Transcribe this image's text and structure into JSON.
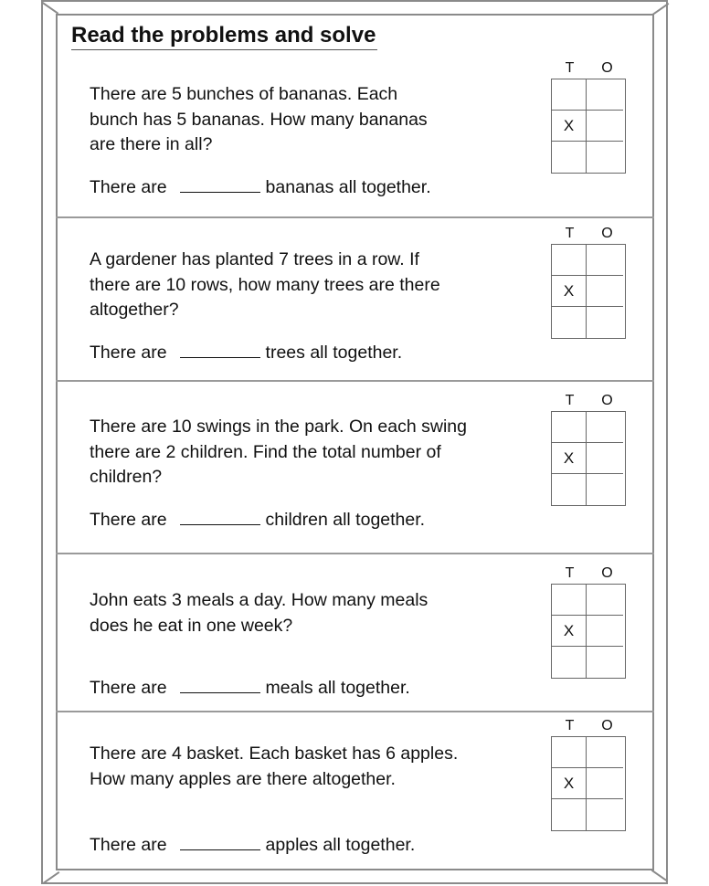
{
  "title": "Read the problems and solve",
  "columns": {
    "tens": "T",
    "ones": "O"
  },
  "mark": "X",
  "answer_prefix": "There are",
  "problems": [
    {
      "lines": [
        "There are 5 bunches of bananas. Each",
        "bunch has 5 bananas. How many bananas",
        "are there in all?"
      ],
      "answer_suffix": "bananas all together."
    },
    {
      "lines": [
        "A gardener has planted 7 trees in a row. If",
        "there are 10 rows, how many trees are there",
        "altogether?"
      ],
      "answer_suffix": "trees all together."
    },
    {
      "lines": [
        "There are 10 swings in the park. On each swing",
        "there are 2 children. Find the total number of",
        "children?"
      ],
      "answer_suffix": "children all together."
    },
    {
      "lines": [
        "John eats 3 meals a day. How many meals",
        "does he eat in one week?"
      ],
      "answer_suffix": "meals all together."
    },
    {
      "lines": [
        "There are 4 basket. Each basket has 6 apples.",
        "How many apples are there altogether."
      ],
      "answer_suffix": "apples all together."
    }
  ]
}
